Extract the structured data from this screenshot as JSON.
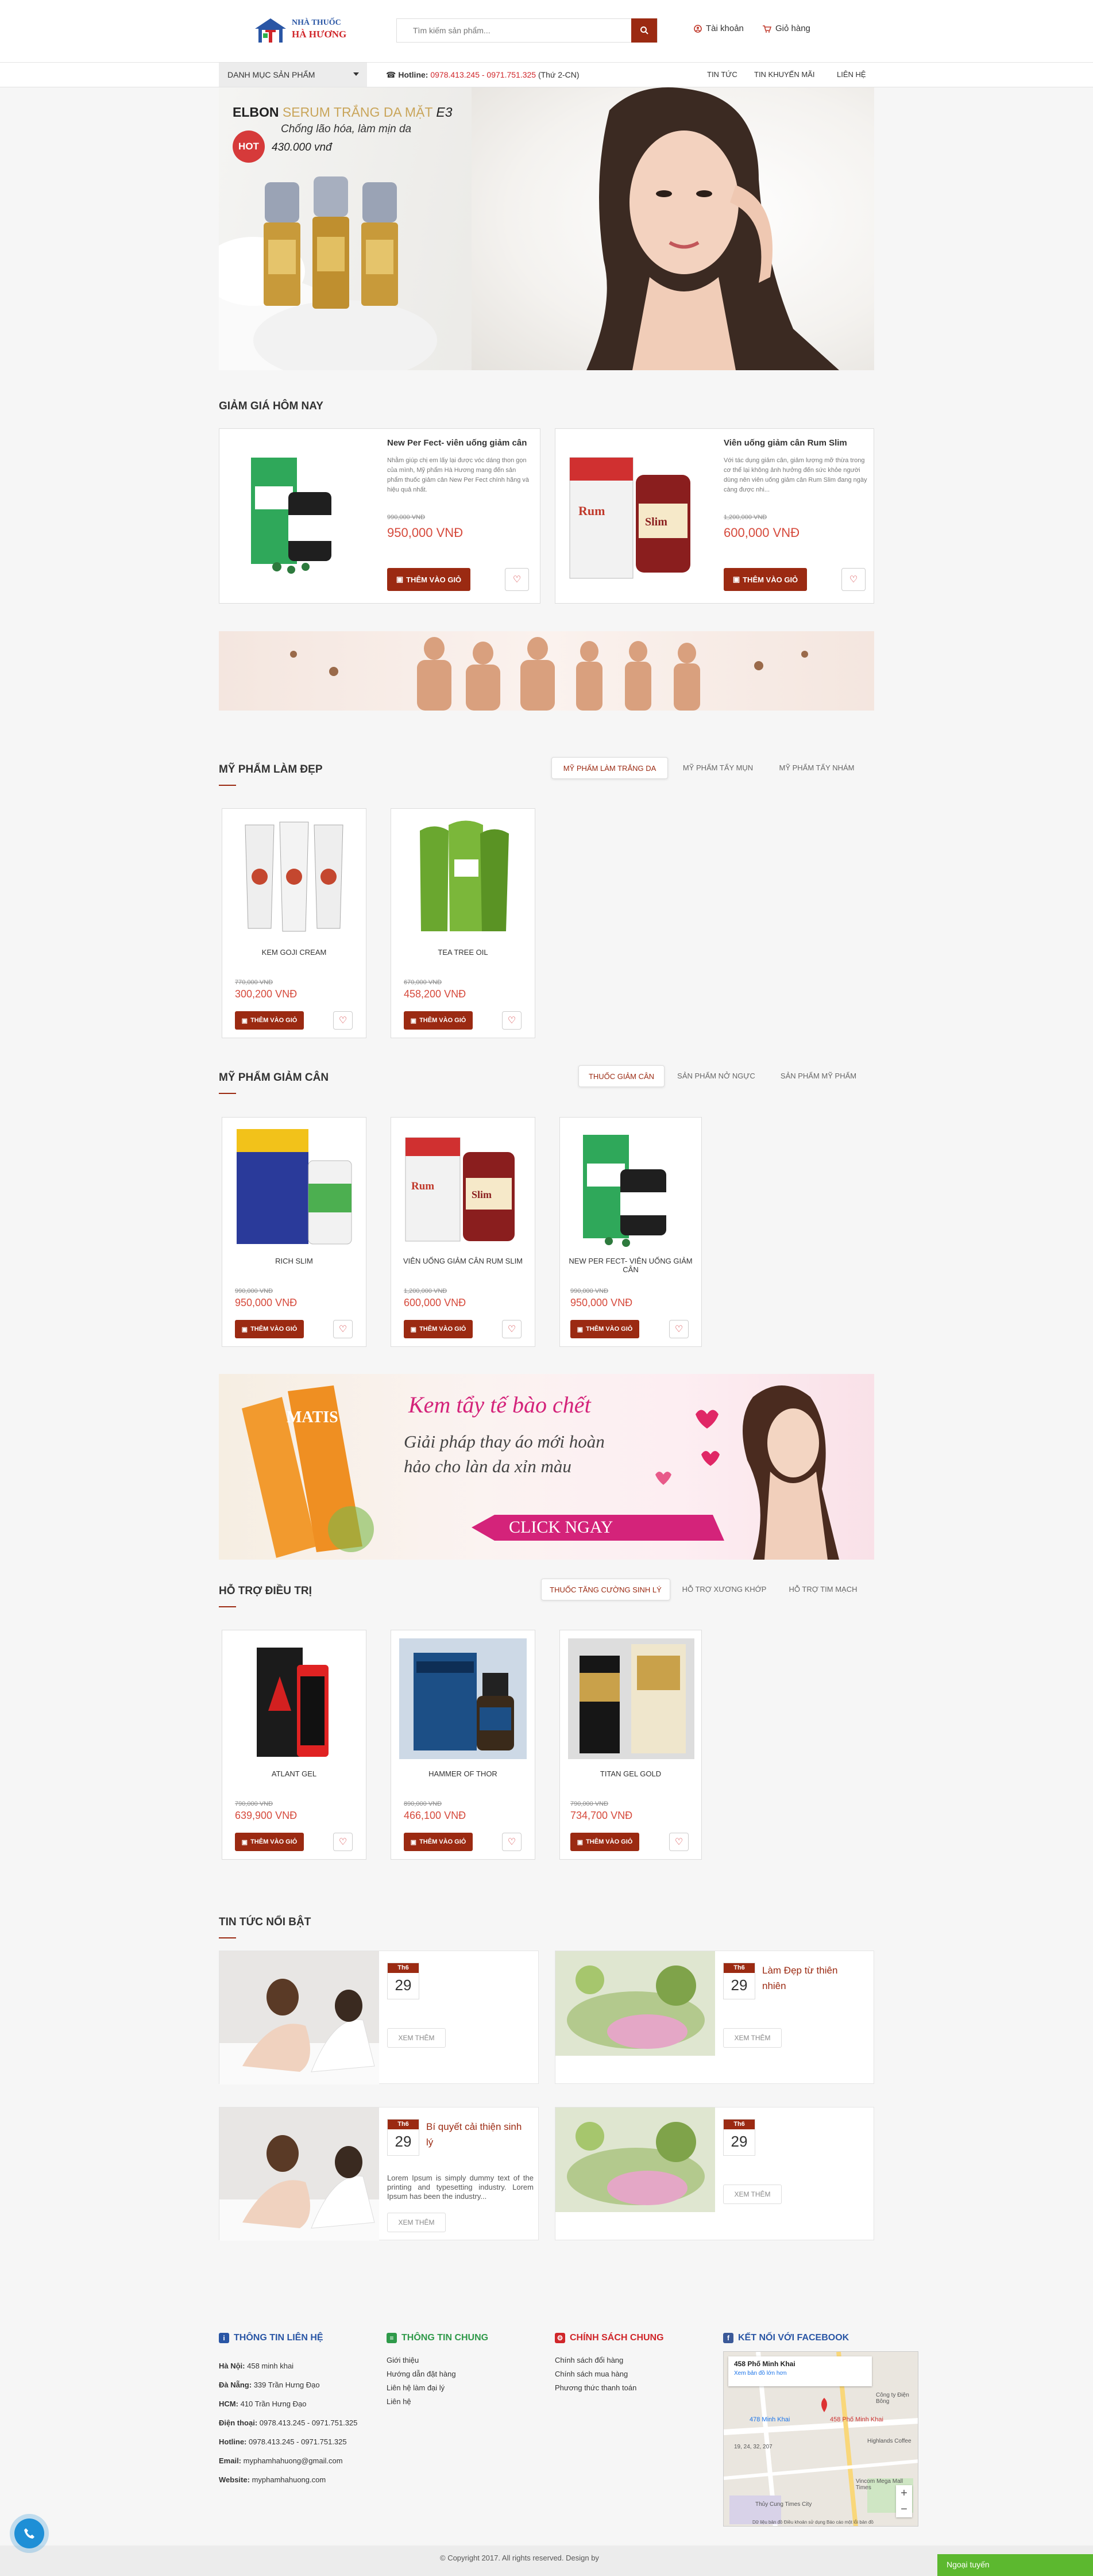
{
  "header": {
    "logo_line1": "NHÀ THUỐC",
    "logo_line2": "HÀ HƯƠNG",
    "search_placeholder": "Tìm kiếm sản phẩm...",
    "account": "Tài khoản",
    "cart": "Giỏ hàng"
  },
  "nav": {
    "category": "DANH MỤC SẢN PHẨM",
    "hotline_label": "Hotline:",
    "hotline_numbers": "0978.413.245 - 0971.751.325",
    "hotline_hours": "(Thứ 2-CN)",
    "links": [
      "TIN TỨC",
      "TIN KHUYẾN MÃI",
      "LIÊN HỆ"
    ]
  },
  "banner": {
    "brand": "ELBON",
    "product": "SERUM TRẮNG DA MẶT",
    "variant": "E3",
    "tagline": "Chống lão hóa, làm mịn da",
    "hot": "HOT",
    "price": "430.000 vnđ"
  },
  "deals": {
    "title": "GIẢM GIÁ HÔM NAY",
    "items": [
      {
        "name": "New Per Fect- viên uống giảm cân",
        "desc": "Nhằm giúp chị em lấy lại được vóc dáng thon gọn của mình, Mỹ phẩm Hà Hương mang đến sản phẩm thuốc giảm cân New Per Fect chính hãng và hiệu quả nhất.",
        "old_price": "990,000 VNĐ",
        "price": "950,000 VNĐ",
        "button": "THÊM VÀO GIỎ"
      },
      {
        "name": "Viên uống giảm cân Rum Slim",
        "desc": "Với tác dụng giảm cân, giảm lượng mỡ thừa trong cơ thể lại không ảnh hưởng đến sức khỏe người dùng nên viên uống giảm cân Rum Slim đang ngày càng được nhi...",
        "old_price": "1,200,000 VNĐ",
        "price": "600,000 VNĐ",
        "button": "THÊM VÀO GIỎ"
      }
    ]
  },
  "beauty": {
    "title": "MỸ PHẨM LÀM ĐẸP",
    "tabs": [
      "MỸ PHẨM LÀM TRẮNG DA",
      "MỸ PHẨM TẨY MỤN",
      "MỸ PHẨM TẨY NHÁM"
    ],
    "items": [
      {
        "name": "KEM GOJI CREAM",
        "old_price": "770,000 VNĐ",
        "price": "300,200 VNĐ",
        "button": "THÊM VÀO GIỎ"
      },
      {
        "name": "TEA TREE OIL",
        "old_price": "670,000 VNĐ",
        "price": "458,200 VNĐ",
        "button": "THÊM VÀO GIỎ"
      }
    ]
  },
  "slimming": {
    "title": "MỸ PHẨM GIẢM CÂN",
    "tabs": [
      "THUỐC GIẢM CÂN",
      "SẢN PHẨM NỞ NGỰC",
      "SẢN PHẨM MỸ PHẨM"
    ],
    "items": [
      {
        "name": "RICH SLIM",
        "old_price": "990,000 VNĐ",
        "price": "950,000 VNĐ",
        "button": "THÊM VÀO GIỎ"
      },
      {
        "name": "VIÊN UỐNG GIẢM CÂN RUM SLIM",
        "old_price": "1,200,000 VNĐ",
        "price": "600,000 VNĐ",
        "button": "THÊM VÀO GIỎ"
      },
      {
        "name": "NEW PER FECT- VIÊN UỐNG GIẢM CÂN",
        "old_price": "990,000 VNĐ",
        "price": "950,000 VNĐ",
        "button": "THÊM VÀO GIỎ"
      }
    ]
  },
  "promo": {
    "brand": "MATIS",
    "headline": "Kem tẩy tế bào chết",
    "sub1": "Giải pháp thay áo mới hoàn",
    "sub2": "hảo cho làn da xỉn màu",
    "cta": "CLICK NGAY"
  },
  "support": {
    "title": "HỖ TRỢ ĐIỀU TRỊ",
    "tabs": [
      "THUỐC TĂNG CƯỜNG SINH LÝ",
      "HỖ TRỢ XƯƠNG KHỚP",
      "HỖ TRỢ TIM MẠCH"
    ],
    "items": [
      {
        "name": "ATLANT GEL",
        "old_price": "790,000 VNĐ",
        "price": "639,900 VNĐ",
        "button": "THÊM VÀO GIỎ"
      },
      {
        "name": "HAMMER OF THOR",
        "old_price": "890,000 VNĐ",
        "price": "466,100 VNĐ",
        "button": "THÊM VÀO GIỎ"
      },
      {
        "name": "TITAN GEL GOLD",
        "old_price": "790,000 VNĐ",
        "price": "734,700 VNĐ",
        "button": "THÊM VÀO GIỎ"
      }
    ]
  },
  "news": {
    "title": "TIN TỨC NỔI BẬT",
    "items": [
      {
        "month": "Th6",
        "day": "29",
        "title": "",
        "excerpt": "",
        "button": "XEM THÊM"
      },
      {
        "month": "Th6",
        "day": "29",
        "title": "Làm Đẹp từ thiên nhiên",
        "excerpt": "",
        "button": "XEM THÊM"
      },
      {
        "month": "Th6",
        "day": "29",
        "title": "Bí quyết cải thiện sinh lý",
        "excerpt": "Lorem Ipsum is simply dummy text of the printing and typesetting industry. Lorem Ipsum has been the industry...",
        "button": "XEM THÊM"
      },
      {
        "month": "Th6",
        "day": "29",
        "title": "",
        "excerpt": "",
        "button": "XEM THÊM"
      }
    ]
  },
  "footer": {
    "contact_title": "THÔNG TIN LIÊN HỆ",
    "contact": [
      {
        "label": "Hà Nội:",
        "value": "458 minh khai"
      },
      {
        "label": "Đà Nẵng:",
        "value": "339 Trần Hưng Đạo"
      },
      {
        "label": "HCM:",
        "value": "410 Trần Hưng Đạo"
      },
      {
        "label": "Điện thoại:",
        "value": "0978.413.245 - 0971.751.325"
      },
      {
        "label": "Hotline:",
        "value": "0978.413.245 - 0971.751.325"
      },
      {
        "label": "Email:",
        "value": "myphamhahuong@gmail.com"
      },
      {
        "label": "Website:",
        "value": "myphamhahuong.com"
      }
    ],
    "general_title": "THÔNG TIN CHUNG",
    "general": [
      "Giới thiệu",
      "Hướng dẫn đặt hàng",
      "Liên hệ làm đại lý",
      "Liên hệ"
    ],
    "policy_title": "CHÍNH SÁCH CHUNG",
    "policy": [
      "Chính sách đổi hàng",
      "Chính sách mua hàng",
      "Phương thức thanh toán"
    ],
    "fb_title": "KẾT NỐI VỚI FACEBOOK",
    "map_address": "458 Phố Minh Khai",
    "map_sub": "Xem bản đồ lớn hơn",
    "map_labels": [
      "478 Minh Khai",
      "458 Phố Minh Khai",
      "Highlands Coffee",
      "Vincom Mega Mall Times",
      "Thủy Cung Times City",
      "Công ty Điện Bông",
      "19, 24, 32, 207"
    ],
    "map_footer": "Dữ liệu bản đồ   Điều khoản sử dụng   Báo cáo một lỗi bản đồ",
    "copyright": "© Copyright 2017. All rights reserved. Design by",
    "online": "Ngoại tuyến"
  },
  "colors": {
    "brand": "#9b2a12",
    "price": "#d64a3c",
    "bg": "#f6f6f6"
  }
}
